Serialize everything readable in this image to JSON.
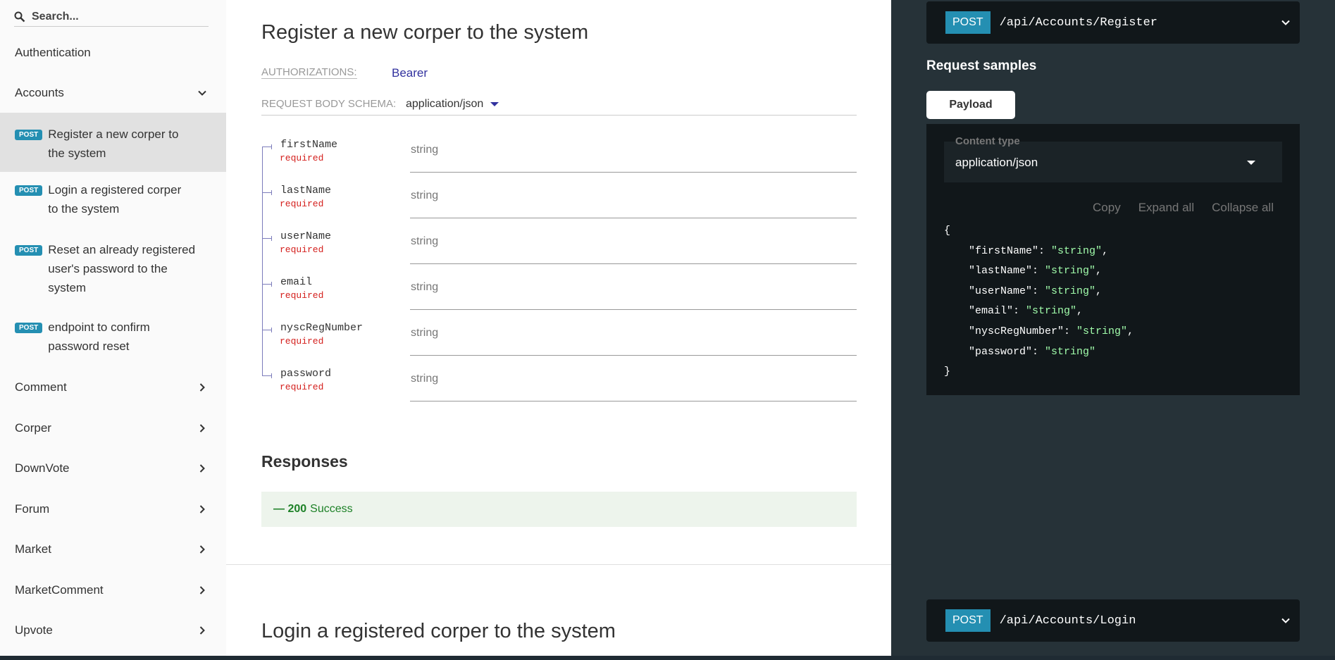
{
  "sidebar": {
    "search_placeholder": "Search...",
    "items": [
      {
        "label": "Authentication",
        "chevron": "none"
      },
      {
        "label": "Accounts",
        "chevron": "down"
      },
      {
        "label": "Comment",
        "chevron": "right"
      },
      {
        "label": "Corper",
        "chevron": "right"
      },
      {
        "label": "DownVote",
        "chevron": "right"
      },
      {
        "label": "Forum",
        "chevron": "right"
      },
      {
        "label": "Market",
        "chevron": "right"
      },
      {
        "label": "MarketComment",
        "chevron": "right"
      },
      {
        "label": "Upvote",
        "chevron": "right"
      }
    ],
    "operations": [
      {
        "method": "post",
        "label_lines": [
          "Register a new corper to",
          "the system"
        ],
        "active": true
      },
      {
        "method": "post",
        "label_lines": [
          "Login a registered corper",
          "to the system"
        ],
        "active": false
      },
      {
        "method": "post",
        "label_lines": [
          "Reset an already registered",
          "user's password to the",
          "system"
        ],
        "active": false
      },
      {
        "method": "post",
        "label_lines": [
          "endpoint to confirm",
          "password reset"
        ],
        "active": false
      }
    ]
  },
  "main": {
    "title": "Register a new corper to the system",
    "authorizations_label": "AUTHORIZATIONS:",
    "authorizations_value": "Bearer",
    "schema_label": "REQUEST BODY SCHEMA:",
    "schema_value": "application/json",
    "fields": [
      {
        "name": "firstName",
        "required": "required",
        "type": "string"
      },
      {
        "name": "lastName",
        "required": "required",
        "type": "string"
      },
      {
        "name": "userName",
        "required": "required",
        "type": "string"
      },
      {
        "name": "email",
        "required": "required",
        "type": "string"
      },
      {
        "name": "nyscRegNumber",
        "required": "required",
        "type": "string"
      },
      {
        "name": "password",
        "required": "required",
        "type": "string"
      }
    ],
    "responses_title": "Responses",
    "response_code": "— 200",
    "response_text": "Success",
    "next_title": "Login a registered corper to the system"
  },
  "right": {
    "endpoint_method": "POST",
    "endpoint_path": "/api/Accounts/Register",
    "samples_title": "Request samples",
    "payload_tab": "Payload",
    "content_type_label": "Content type",
    "content_type_value": "application/json",
    "actions": {
      "copy": "Copy",
      "expand": "Expand all",
      "collapse": "Collapse all"
    },
    "code": {
      "open": "{",
      "close": "}",
      "lines": [
        {
          "key": "\"firstName\"",
          "value": "\"string\"",
          "comma": ","
        },
        {
          "key": "\"lastName\"",
          "value": "\"string\"",
          "comma": ","
        },
        {
          "key": "\"userName\"",
          "value": "\"string\"",
          "comma": ","
        },
        {
          "key": "\"email\"",
          "value": "\"string\"",
          "comma": ","
        },
        {
          "key": "\"nyscRegNumber\"",
          "value": "\"string\"",
          "comma": ","
        },
        {
          "key": "\"password\"",
          "value": "\"string\"",
          "comma": ""
        }
      ]
    },
    "next_endpoint_method": "POST",
    "next_endpoint_path": "/api/Accounts/Login"
  },
  "colors": {
    "accent": "#32329f",
    "post_badge": "#248fb2",
    "required": "#d41f1c",
    "success": "#1d8127",
    "code_string": "#a0fbaa",
    "right_panel": "#263238"
  }
}
